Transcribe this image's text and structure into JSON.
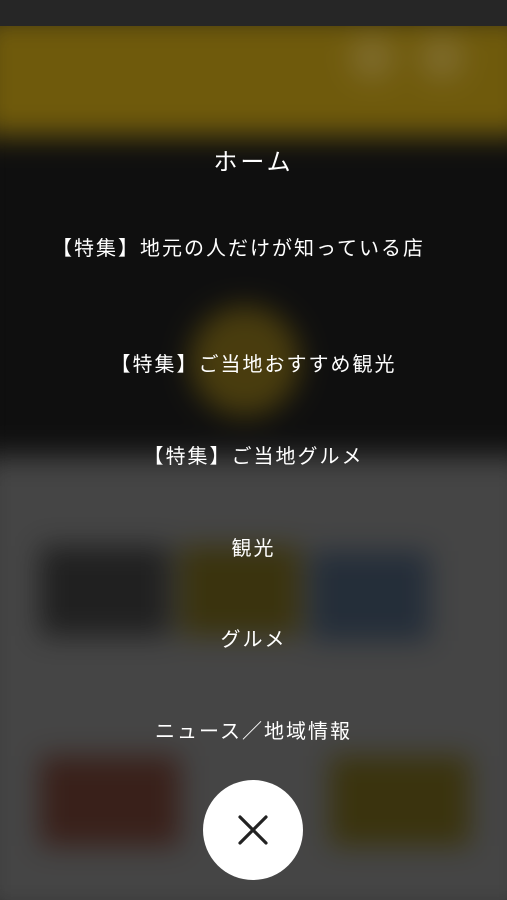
{
  "menu": {
    "items": [
      {
        "label": "ホーム"
      },
      {
        "label": "【特集】地元の人だけが知っている店"
      },
      {
        "label": "【特集】ご当地おすすめ観光"
      },
      {
        "label": "【特集】ご当地グルメ"
      },
      {
        "label": "観光"
      },
      {
        "label": "グルメ"
      },
      {
        "label": "ニュース／地域情報"
      }
    ],
    "close_icon": "close-icon"
  },
  "colors": {
    "header_yellow": "#8f7410",
    "overlay_text": "#ffffff",
    "close_button_bg": "#ffffff",
    "close_icon_color": "#222222"
  }
}
